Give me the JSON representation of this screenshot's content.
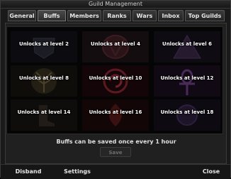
{
  "window": {
    "title": "Guild Management"
  },
  "tabs": [
    {
      "label": "General"
    },
    {
      "label": "Buffs"
    },
    {
      "label": "Members"
    },
    {
      "label": "Ranks"
    },
    {
      "label": "Wars"
    },
    {
      "label": "Inbox"
    },
    {
      "label": "Top Guilds"
    }
  ],
  "active_tab": "Buffs",
  "buffs": [
    {
      "label": "Unlocks at level 2"
    },
    {
      "label": "Unlocks at level 4"
    },
    {
      "label": "Unlocks at level 6"
    },
    {
      "label": "Unlocks at level 8"
    },
    {
      "label": "Unlocks at level 10"
    },
    {
      "label": "Unlocks at level 12"
    },
    {
      "label": "Unlocks at level 14"
    },
    {
      "label": "Unlocks at level 16"
    },
    {
      "label": "Unlocks at level 18"
    }
  ],
  "note": "Buffs can be saved once every 1 hour",
  "buttons": {
    "save": "Save",
    "disband": "Disband",
    "settings": "Settings",
    "close": "Close"
  },
  "colors": {
    "accent": "#7a1a3a",
    "text": "#ffffff"
  }
}
